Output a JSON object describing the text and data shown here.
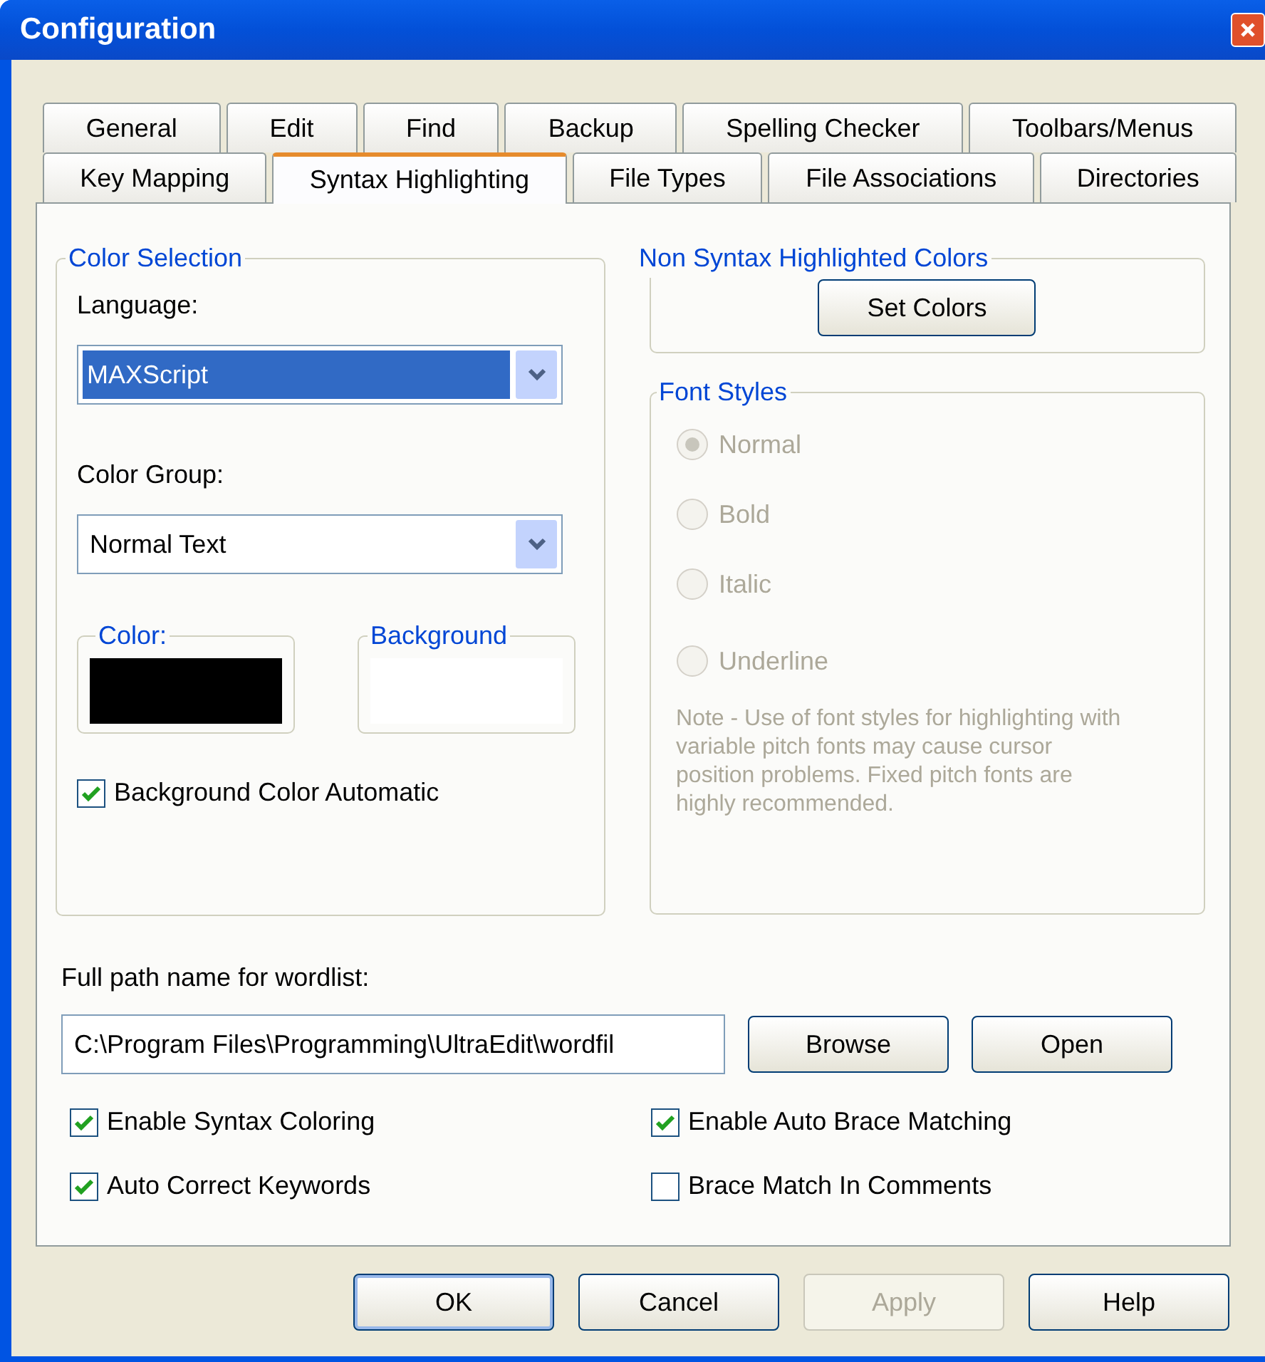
{
  "window": {
    "title": "Configuration"
  },
  "tab_rows": [
    {
      "tabs": [
        {
          "label": "General",
          "selected": false
        },
        {
          "label": "Edit",
          "selected": false
        },
        {
          "label": "Find",
          "selected": false
        },
        {
          "label": "Backup",
          "selected": false
        },
        {
          "label": "Spelling Checker",
          "selected": false
        },
        {
          "label": "Toolbars/Menus",
          "selected": false
        }
      ]
    },
    {
      "tabs": [
        {
          "label": "Key Mapping",
          "selected": false
        },
        {
          "label": "Syntax Highlighting",
          "selected": true
        },
        {
          "label": "File Types",
          "selected": false
        },
        {
          "label": "File Associations",
          "selected": false
        },
        {
          "label": "Directories",
          "selected": false
        }
      ]
    }
  ],
  "color_selection": {
    "legend": "Color Selection",
    "language": {
      "label": "Language:",
      "value": "MAXScript",
      "focused": true
    },
    "color_group": {
      "label": "Color Group:",
      "value": "Normal Text",
      "focused": false
    },
    "swatches": [
      {
        "legend": "Color:",
        "color": "#000000"
      },
      {
        "legend": "Background",
        "color": "#ffffff"
      }
    ],
    "background_auto": {
      "label": "Background Color Automatic",
      "checked": true
    }
  },
  "non_syntax": {
    "legend": "Non Syntax Highlighted Colors",
    "button": "Set Colors"
  },
  "font_styles": {
    "legend": "Font Styles",
    "disabled": true,
    "options": [
      {
        "label": "Normal",
        "selected": true
      },
      {
        "label": "Bold",
        "selected": false
      },
      {
        "label": "Italic",
        "selected": false
      },
      {
        "label": "Underline",
        "selected": false
      }
    ],
    "note": "Note - Use of font styles for highlighting with variable pitch fonts may cause cursor position problems. Fixed pitch fonts are highly recommended."
  },
  "wordlist": {
    "label": "Full path name for wordlist:",
    "value": "C:\\Program Files\\Programming\\UltraEdit\\wordfil",
    "buttons": [
      "Browse",
      "Open"
    ]
  },
  "options": [
    {
      "label": "Enable Syntax Coloring",
      "checked": true
    },
    {
      "label": "Enable Auto Brace Matching",
      "checked": true
    },
    {
      "label": "Auto Correct Keywords",
      "checked": true
    },
    {
      "label": "Brace Match In Comments",
      "checked": false
    }
  ],
  "footer_buttons": [
    {
      "label": "OK",
      "default": true,
      "disabled": false
    },
    {
      "label": "Cancel",
      "default": false,
      "disabled": false
    },
    {
      "label": "Apply",
      "default": false,
      "disabled": true
    },
    {
      "label": "Help",
      "default": false,
      "disabled": false
    }
  ]
}
